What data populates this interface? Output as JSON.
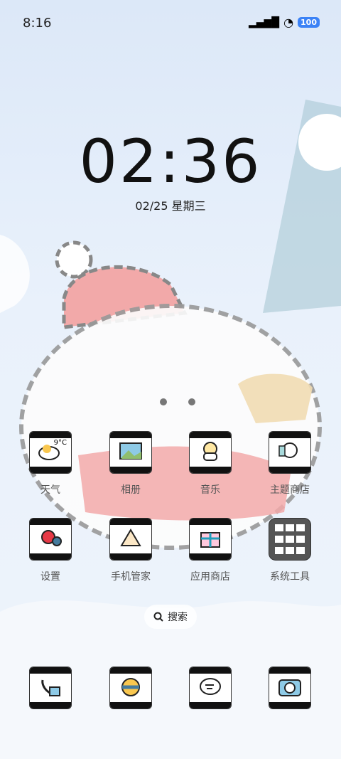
{
  "status_bar": {
    "time": "8:16",
    "battery": "100"
  },
  "lock": {
    "time": "02:36",
    "date": "02/25 星期三"
  },
  "apps": [
    {
      "label": "天气",
      "icon": "weather-icon",
      "temp": "9°C"
    },
    {
      "label": "相册",
      "icon": "gallery-icon"
    },
    {
      "label": "音乐",
      "icon": "music-icon"
    },
    {
      "label": "主题商店",
      "icon": "themes-icon"
    },
    {
      "label": "设置",
      "icon": "settings-icon"
    },
    {
      "label": "手机管家",
      "icon": "security-icon"
    },
    {
      "label": "应用商店",
      "icon": "app-store-icon"
    },
    {
      "label": "系统工具",
      "icon": "folder-icon"
    }
  ],
  "search": {
    "label": "搜索"
  },
  "dock": [
    {
      "icon": "phone-icon"
    },
    {
      "icon": "browser-icon"
    },
    {
      "icon": "messages-icon"
    },
    {
      "icon": "camera-icon"
    }
  ]
}
